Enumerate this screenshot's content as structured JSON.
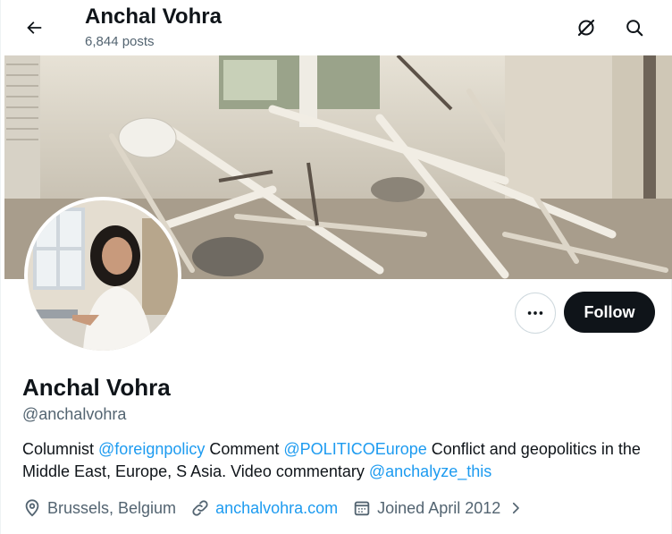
{
  "header": {
    "title": "Anchal Vohra",
    "post_count": "6,844 posts",
    "back_icon": "arrow-left-icon",
    "right_icons": [
      "grok-icon",
      "search-icon"
    ]
  },
  "profile": {
    "display_name": "Anchal Vohra",
    "handle": "@anchalvohra",
    "follow_label": "Follow",
    "more_icon": "more-icon",
    "bio": {
      "t1": "Columnist ",
      "m1": "@foreignpolicy",
      "t2": " Comment ",
      "m2": "@POLITICOEurope",
      "t3": " Conflict and geopolitics in the Middle East, Europe, S Asia. Video commentary ",
      "m3": "@anchalyze_this"
    },
    "location": "Brussels, Belgium",
    "website": "anchalvohra.com",
    "joined": "Joined April 2012"
  },
  "colors": {
    "accent": "#1d9bf0",
    "text": "#0f1419",
    "secondary": "#536471",
    "follow_bg": "#0f1419"
  }
}
